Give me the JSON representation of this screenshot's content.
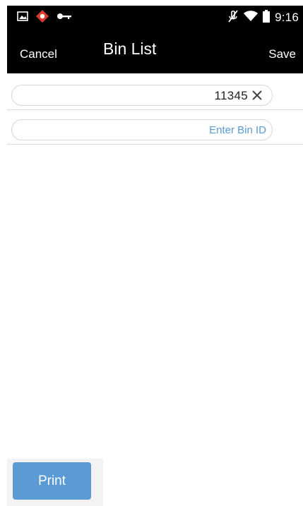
{
  "status_bar": {
    "time": "9:16",
    "icons": [
      "image-icon",
      "alert-diamond-icon",
      "key-icon",
      "mute-icon",
      "wifi-icon",
      "battery-icon"
    ]
  },
  "action_bar": {
    "cancel_label": "Cancel",
    "title": "Bin List",
    "save_label": "Save"
  },
  "form": {
    "bin_value": "11345",
    "bin_input_placeholder": "Enter Bin ID",
    "bin_input_value": ""
  },
  "footer": {
    "print_label": "Print"
  },
  "colors": {
    "bar_background": "#000000",
    "accent": "#5b9bd5",
    "alert_red": "#d83a2f",
    "field_border": "#d7d7d7"
  }
}
